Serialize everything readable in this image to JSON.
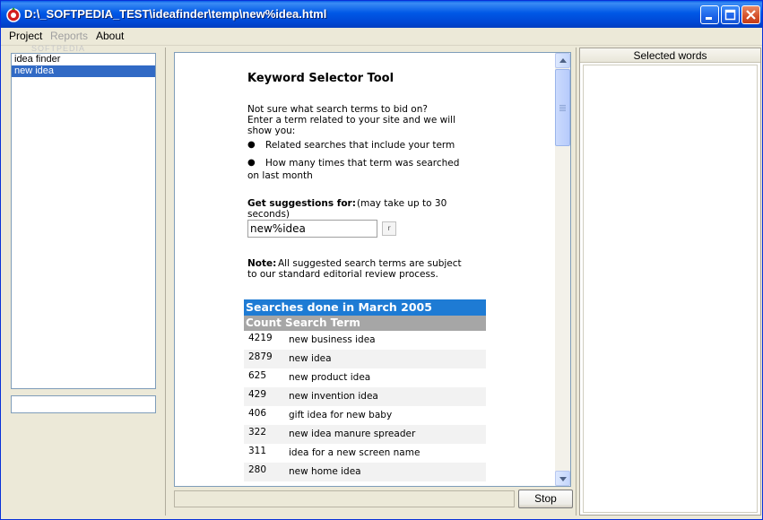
{
  "window": {
    "title": "D:\\_SOFTPEDIA_TEST\\ideafinder\\temp\\new%idea.html"
  },
  "menu": {
    "items": [
      {
        "label": "Project",
        "enabled": true
      },
      {
        "label": "Reports",
        "enabled": false
      },
      {
        "label": "About",
        "enabled": true
      }
    ]
  },
  "watermark": "SOFTPEDIA",
  "left_list": {
    "items": [
      {
        "label": "idea finder",
        "selected": false
      },
      {
        "label": "new idea",
        "selected": true
      }
    ]
  },
  "page": {
    "title": "Keyword Selector Tool",
    "intro_1": "Not sure what search terms to bid on?",
    "intro_2": "Enter a term related to your site and we will",
    "intro_3": "show you:",
    "bullet_1": "Related searches that include your term",
    "bullet_2a": "How many times that term was searched",
    "bullet_2b": "on last month",
    "suggest_label": "Get suggestions for:",
    "suggest_hint_1": "(may take up to 30",
    "suggest_hint_2": "seconds)",
    "suggest_value": "new%idea",
    "suggest_button": "r",
    "note_label": "Note:",
    "note_1": "All suggested search terms are subject",
    "note_2": "to our standard editorial review process.",
    "table": {
      "heading": "Searches done in March 2005",
      "columns_label": "Count Search Term",
      "rows": [
        {
          "count": "4219",
          "term": "new business idea"
        },
        {
          "count": "2879",
          "term": "new idea"
        },
        {
          "count": "625",
          "term": "new product idea"
        },
        {
          "count": "429",
          "term": "new invention idea"
        },
        {
          "count": "406",
          "term": "gift idea for new baby"
        },
        {
          "count": "322",
          "term": "new idea manure spreader"
        },
        {
          "count": "311",
          "term": "idea for a new screen name"
        },
        {
          "count": "280",
          "term": "new home idea"
        }
      ]
    }
  },
  "status": {
    "stop_label": "Stop"
  },
  "right_panel": {
    "header": "Selected words"
  },
  "colors": {
    "titlebar": "#0058e6",
    "selection": "#316ac5",
    "table_heading": "#1e7bd4",
    "table_subheading": "#a6a6a6"
  },
  "icons": [
    "app-icon",
    "minimize-icon",
    "maximize-icon",
    "close-icon",
    "scroll-up-arrow-icon",
    "scroll-down-arrow-icon"
  ]
}
